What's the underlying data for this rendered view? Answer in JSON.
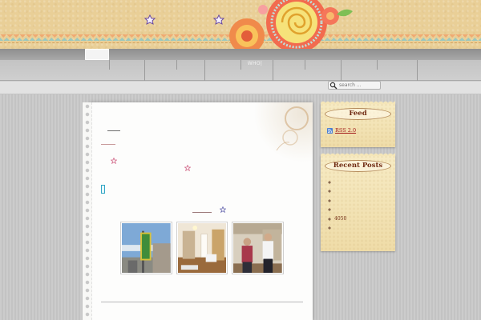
{
  "nav": {
    "label": "WHO|"
  },
  "search": {
    "placeholder": "search ..."
  },
  "sidebar": {
    "feed": {
      "title": "Feed",
      "link": "RSS 2.0"
    },
    "recent": {
      "title": "Recent Posts",
      "items": [
        "",
        "",
        "",
        "",
        "4050",
        ""
      ]
    }
  },
  "colors": {
    "header": "#e9cf97",
    "nav": "#bdbdbd",
    "note": "#f5e6b8",
    "note_title": "#6f2a12",
    "link": "#a31c1c",
    "accent_cyan": "#32a6c4",
    "star": "#7b5ea7"
  },
  "icons": {
    "header_stars": "star-icon",
    "feed": "rss-icon",
    "search": "magnifier-icon",
    "bullet": "diamond-bullet-icon"
  }
}
